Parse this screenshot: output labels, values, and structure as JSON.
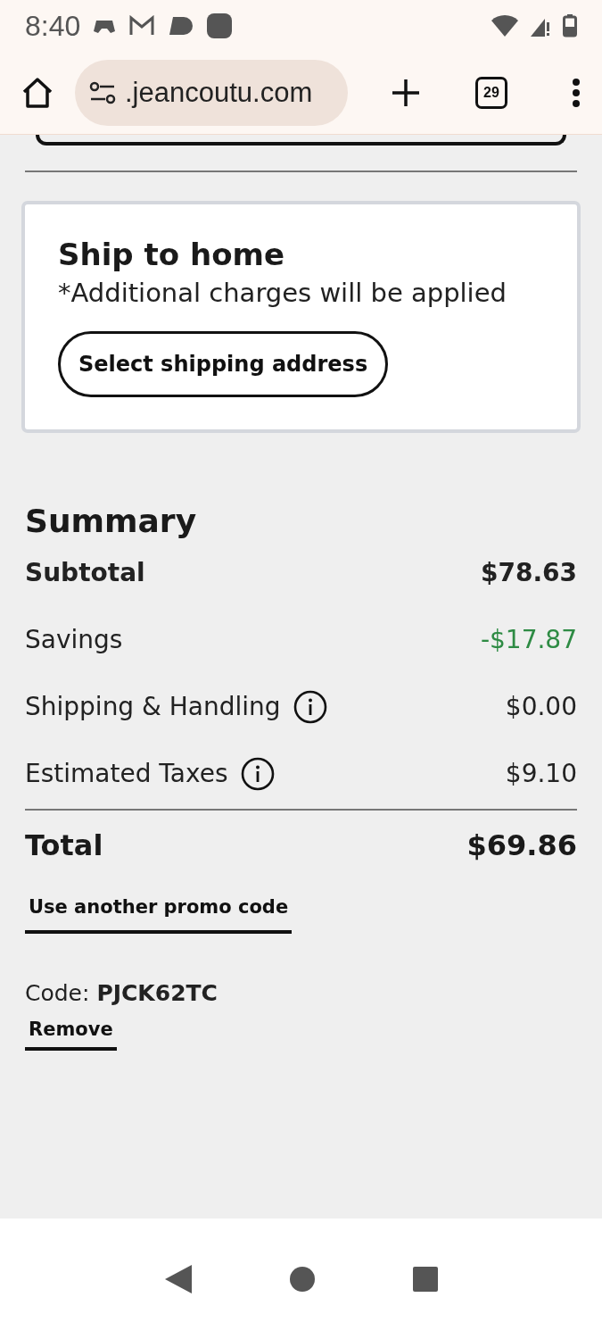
{
  "status_bar": {
    "time": "8:40"
  },
  "browser": {
    "url": ".jeancoutu.com",
    "tab_count": "29"
  },
  "shipping": {
    "title": "Ship to home",
    "note": "*Additional charges will be applied",
    "button": "Select shipping address"
  },
  "summary": {
    "title": "Summary",
    "rows": [
      {
        "label": "Subtotal",
        "value": "$78.63",
        "kind": "bold",
        "info": false
      },
      {
        "label": "Savings",
        "value": "-$17.87",
        "kind": "savings",
        "info": false
      },
      {
        "label": "Shipping & Handling",
        "value": "$0.00",
        "kind": "normal",
        "info": true
      },
      {
        "label": "Estimated Taxes",
        "value": "$9.10",
        "kind": "normal",
        "info": true
      }
    ],
    "total": {
      "label": "Total",
      "value": "$69.86"
    },
    "promo_link": "Use another promo code",
    "code_label": "Code:",
    "code": "PJCK62TC",
    "remove": "Remove"
  }
}
